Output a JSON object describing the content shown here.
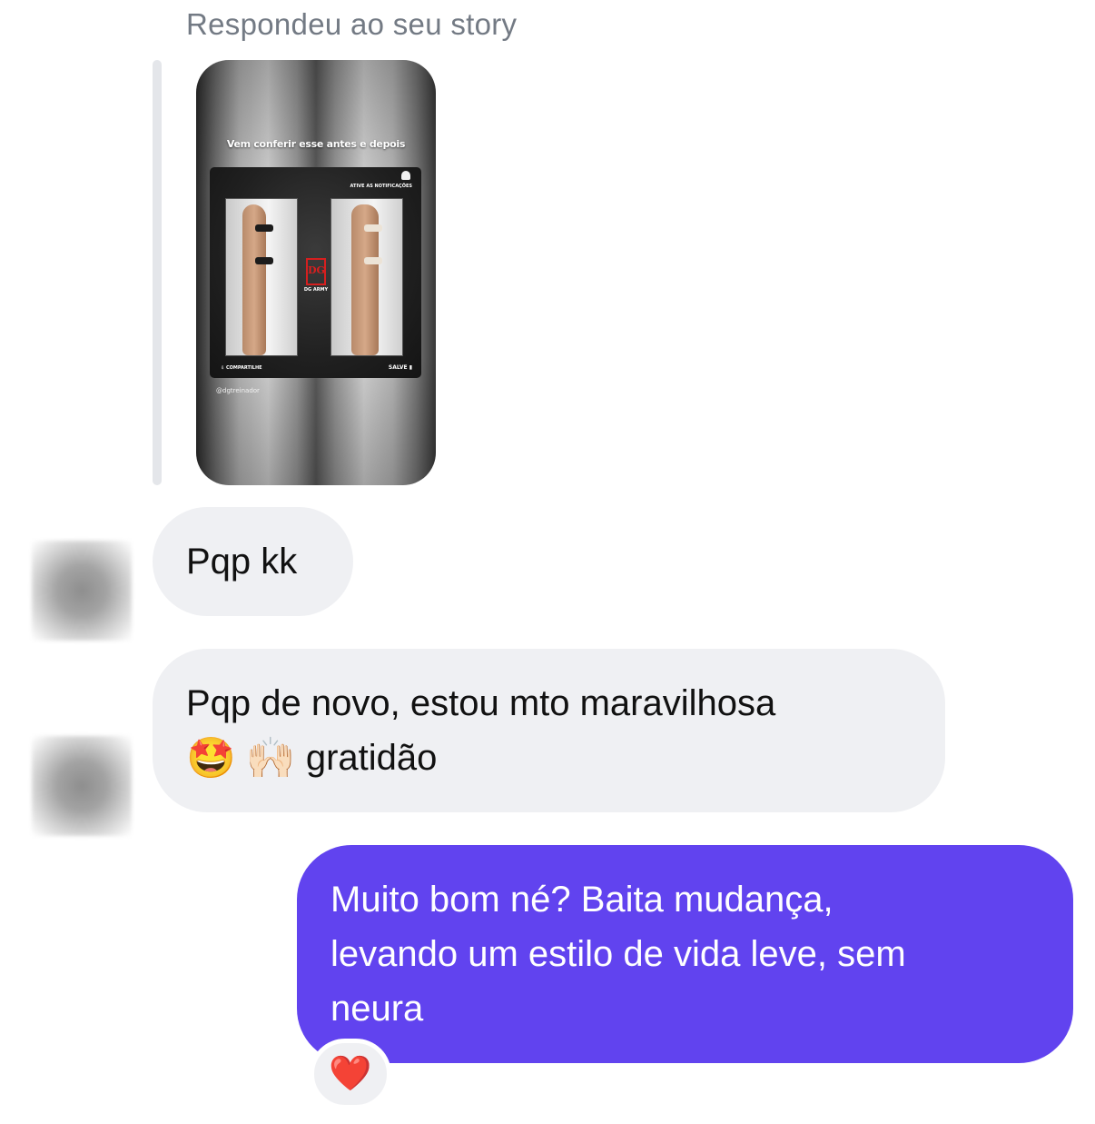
{
  "reply_context": {
    "label": "Respondeu ao seu story"
  },
  "story": {
    "headline": "Vem conferir esse antes e depois",
    "notification_text": "ATIVE AS NOTIFICAÇÕES",
    "brand_mark": "DG",
    "brand_name": "DG ARMY",
    "share_label": "COMPARTILHE",
    "save_label": "SALVE",
    "handle": "@dgtreinador"
  },
  "messages": [
    {
      "direction": "incoming",
      "lines": [
        "Pqp kk"
      ]
    },
    {
      "direction": "incoming",
      "lines": [
        "Pqp de novo, estou mto maravilhosa"
      ],
      "emoji_line": {
        "emojis": [
          "🤩",
          "🙌🏻"
        ],
        "text": "gratidão"
      }
    },
    {
      "direction": "outgoing",
      "lines": [
        "Muito bom né? Baita mudança,",
        "levando um estilo de vida leve, sem",
        "neura"
      ],
      "reaction": "❤️"
    }
  ],
  "colors": {
    "incoming_bubble": "#eff0f3",
    "outgoing_bubble": "#6143ef",
    "label_gray": "#737a84"
  },
  "icons": {
    "reaction_icon": "red-heart-icon",
    "notification_icon": "bell-icon"
  }
}
